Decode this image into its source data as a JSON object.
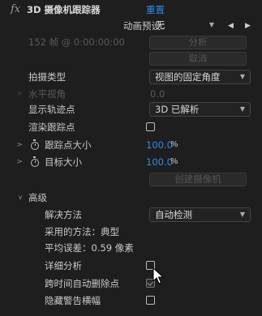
{
  "header": {
    "fx": "fx",
    "title": "3D 摄像机跟踪器",
    "reset": "重置"
  },
  "preset": {
    "label": "动画预设：",
    "value": "无"
  },
  "analyze": {
    "status": "152 帧 @ 0:00:00:00",
    "analyze_button": "分析",
    "cancel_button": "取消"
  },
  "shot_type": {
    "label": "拍摄类型",
    "value": "视图的固定角度"
  },
  "fov": {
    "label": "水平视角",
    "value": "0.0"
  },
  "show_track_points": {
    "label": "显示轨迹点",
    "value": "3D 已解析"
  },
  "render_track_points": {
    "label": "渲染跟踪点"
  },
  "track_point_size": {
    "label": "跟踪点大小",
    "value": "100.0",
    "unit": "%"
  },
  "target_size": {
    "label": "目标大小",
    "value": "100.0",
    "unit": "%"
  },
  "create_camera": {
    "label": "创建摄像机"
  },
  "advanced": {
    "label": "高级",
    "solve_method": {
      "label": "解决方法",
      "value": "自动检测"
    },
    "method_used": "采用的方法：典型",
    "avg_error": "平均误差：0.59 像素",
    "detailed_analysis": {
      "label": "详细分析",
      "checked": false
    },
    "auto_delete": {
      "label": "跨时间自动删除点",
      "checked": true
    },
    "hide_warning": {
      "label": "隐藏警告横幅",
      "checked": false
    }
  },
  "colors": {
    "background": "#1e1e1e",
    "accent": "#2d8ceb",
    "text": "#c9c9c9"
  }
}
